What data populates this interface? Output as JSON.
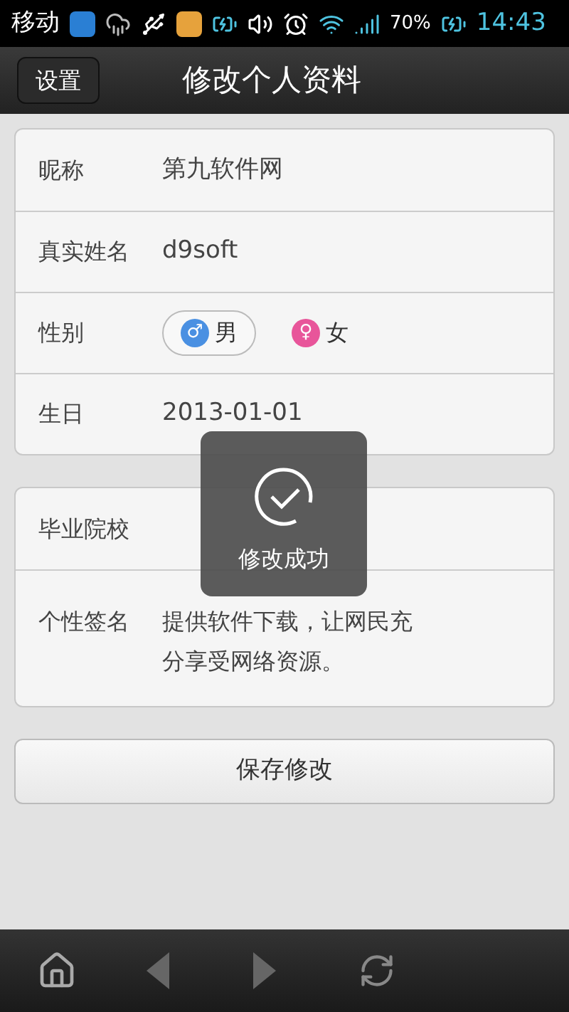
{
  "status_bar": {
    "carrier": "移动",
    "battery": "70%",
    "time": "14:43"
  },
  "nav": {
    "back": "设置",
    "title": "修改个人资料"
  },
  "card1": [
    {
      "kind": "text",
      "label": "昵称",
      "value": "第九软件网"
    },
    {
      "kind": "text",
      "label": "真实姓名",
      "value": "d9soft"
    },
    {
      "kind": "gender",
      "label": "性别",
      "options": [
        {
          "symbol": "♂",
          "label": "男",
          "selected": true,
          "color": "#4a90e2"
        },
        {
          "symbol": "♀",
          "label": "女",
          "selected": false,
          "color": "#e8559a"
        }
      ]
    },
    {
      "kind": "text",
      "label": "生日",
      "value": "2013-01-01"
    }
  ],
  "card2": [
    {
      "kind": "text",
      "label": "毕业院校"
    },
    {
      "kind": "multiline",
      "label": "个性签名",
      "value": "提供软件下载，让网民充",
      "value2": "分享受网络资源。"
    }
  ],
  "save_button": "保存修改",
  "toast": {
    "text": "修改成功"
  }
}
